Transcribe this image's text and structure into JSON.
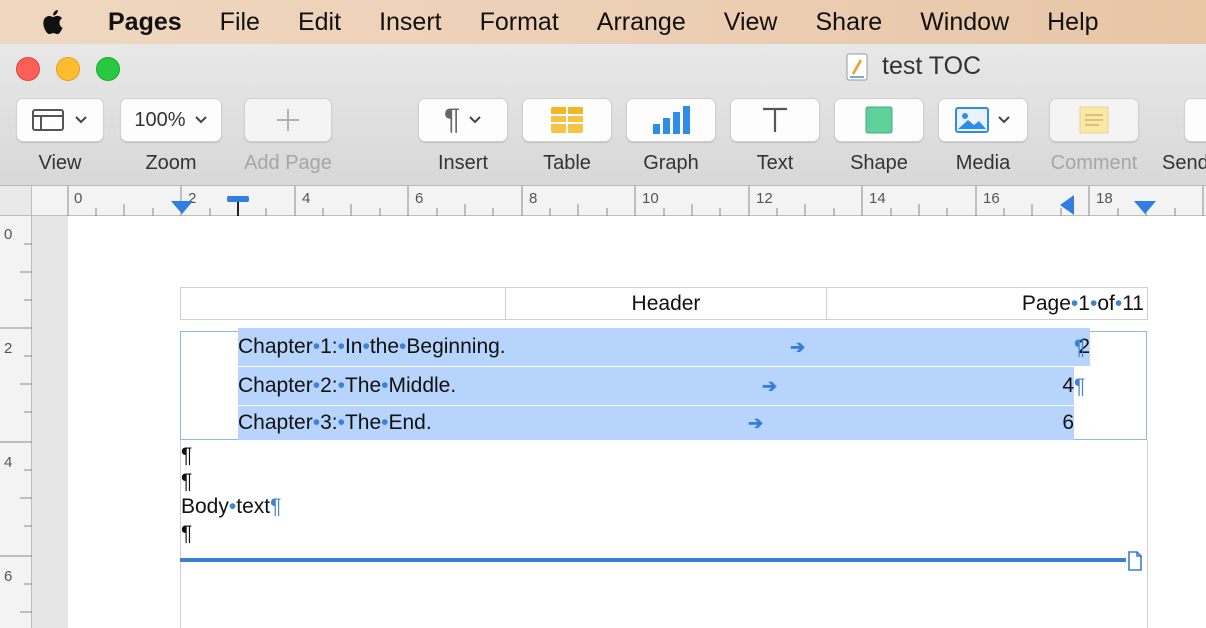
{
  "menubar": {
    "app_name": "Pages",
    "items": [
      "File",
      "Edit",
      "Insert",
      "Format",
      "Arrange",
      "View",
      "Share",
      "Window",
      "Help"
    ]
  },
  "window": {
    "document_title": "test TOC",
    "traffic_lights": {
      "close": "#ff5f57",
      "minimize": "#febc2e",
      "zoom": "#28c840"
    }
  },
  "toolbar": {
    "view_label": "View",
    "zoom_value": "100%",
    "zoom_label": "Zoom",
    "add_page_label": "Add Page",
    "insert_label": "Insert",
    "table_label": "Table",
    "graph_label": "Graph",
    "text_label": "Text",
    "shape_label": "Shape",
    "media_label": "Media",
    "comment_label": "Comment",
    "send_label": "Send"
  },
  "ruler": {
    "horizontal_numbers": [
      "0",
      "2",
      "4",
      "6",
      "8",
      "10",
      "12",
      "14",
      "16",
      "18"
    ],
    "vertical_numbers": [
      "0",
      "2",
      "4",
      "6"
    ]
  },
  "document": {
    "header": {
      "left": "",
      "center": "Header",
      "right_text": "Page",
      "right_num": "1",
      "right_of": "of",
      "right_total": "11"
    },
    "toc": [
      {
        "w1": "Chapter",
        "w2": "1:",
        "w3": "In",
        "w4": "the",
        "w5": "Beginning.",
        "page": "2"
      },
      {
        "w1": "Chapter",
        "w2": "2:",
        "w3": "The",
        "w4": "Middle.",
        "page": "4"
      },
      {
        "w1": "Chapter",
        "w2": "3:",
        "w3": "The",
        "w4": "End.",
        "page": "6"
      }
    ],
    "body_text_1": "Body",
    "body_text_2": "text",
    "symbols": {
      "pilcrow": "¶",
      "space_dot": "•",
      "tab_arrow": "➔"
    }
  },
  "colors": {
    "selection": "#b7d4fc",
    "invisibles": "#3b82d8",
    "section_break": "#3b7dd8"
  }
}
